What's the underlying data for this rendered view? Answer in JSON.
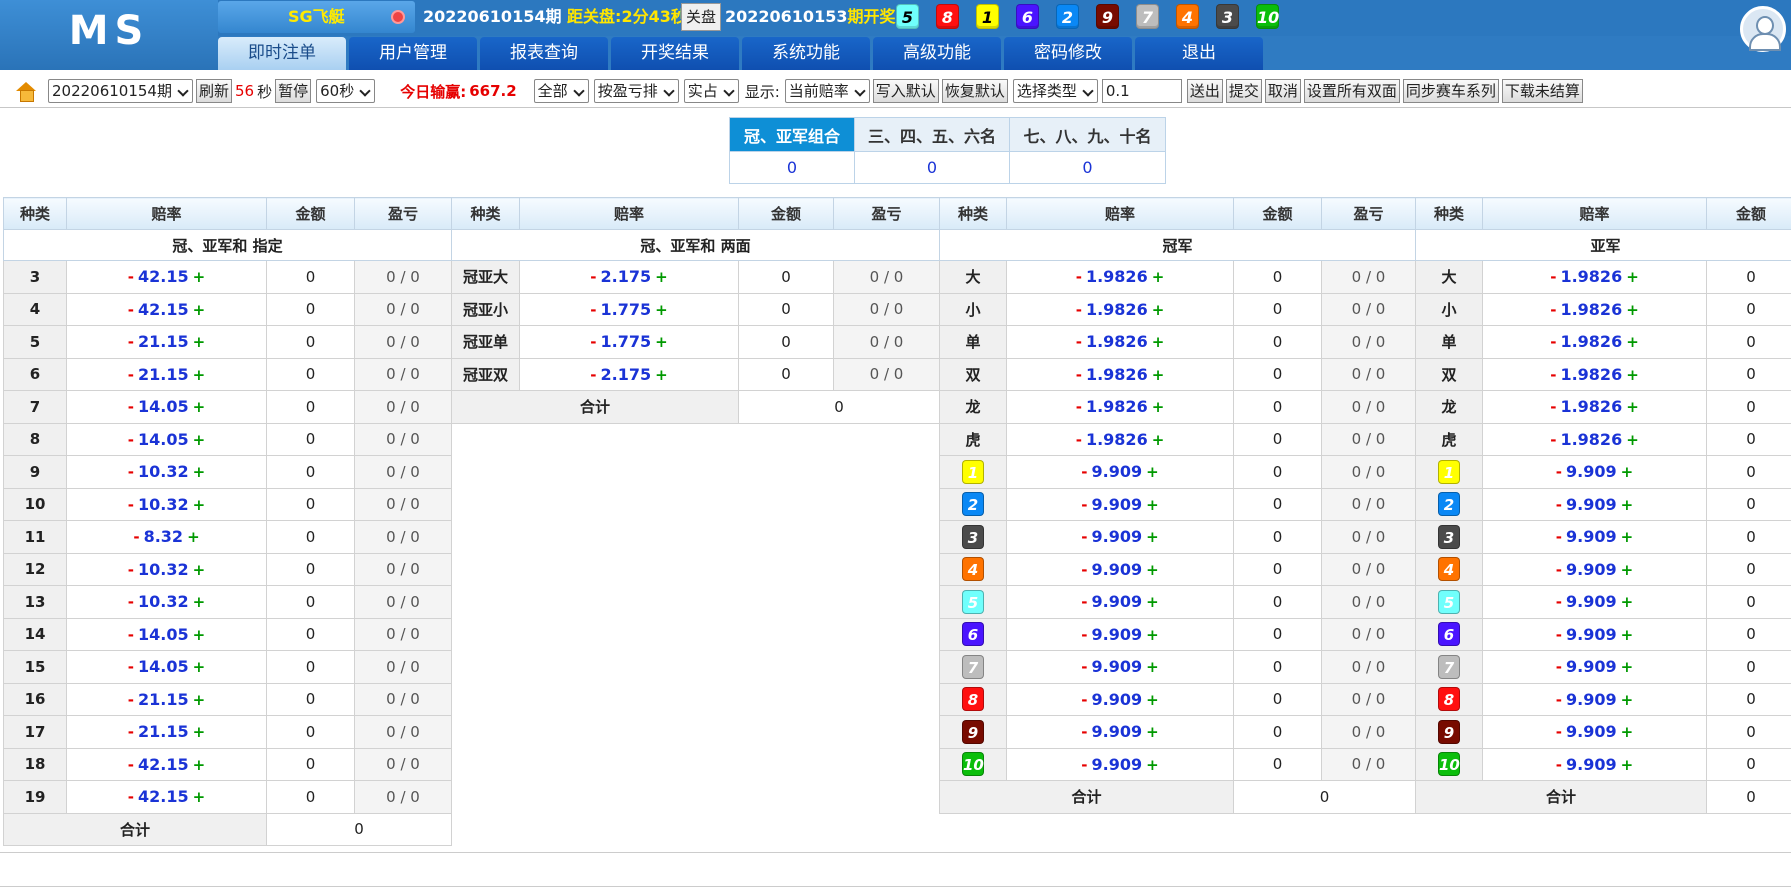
{
  "logo": "MS",
  "game": "SG飞艇",
  "issue": {
    "current": "20220610154期",
    "countdown_label": "距关盘:",
    "countdown": "2分43秒",
    "close_btn": "关盘",
    "prev": "20220610153",
    "prev_label": "期开奖:"
  },
  "result_balls": [
    5,
    8,
    1,
    6,
    2,
    9,
    7,
    4,
    3,
    10
  ],
  "nav": [
    "即时注单",
    "用户管理",
    "报表查询",
    "开奖结果",
    "系统功能",
    "高级功能",
    "密码修改",
    "退出"
  ],
  "toolbar": {
    "period": "20220610154期",
    "refresh": "刷新",
    "seconds": "56",
    "sec_unit": "秒",
    "pause": "暂停",
    "interval": "60秒",
    "win_label": "今日输赢:",
    "win_value": "667.2",
    "all": "全部",
    "sort": "按盈亏排",
    "real": "实占",
    "show_label": "显示:",
    "show": "当前赔率",
    "write_default": "写入默认",
    "restore_default": "恢复默认",
    "select_type": "选择类型",
    "step": "0.1",
    "send": "送出",
    "submit": "提交",
    "cancel": "取消",
    "set_all": "设置所有双面",
    "sync": "同步赛车系列",
    "download": "下载未结算"
  },
  "summary": {
    "headers": [
      "冠、亚军组合",
      "三、四、五、六名",
      "七、八、九、十名"
    ],
    "values": [
      "0",
      "0",
      "0"
    ]
  },
  "colheads": {
    "type": "种类",
    "odds": "赔率",
    "amount": "金额",
    "pl": "盈亏",
    "total": "合计"
  },
  "sections": {
    "sum_specific": "冠、亚军和 指定",
    "sum_two": "冠、亚军和 两面",
    "champion": "冠军",
    "runner": "亚军"
  },
  "sum_specific": [
    {
      "k": "3",
      "o": "42.15"
    },
    {
      "k": "4",
      "o": "42.15"
    },
    {
      "k": "5",
      "o": "21.15"
    },
    {
      "k": "6",
      "o": "21.15"
    },
    {
      "k": "7",
      "o": "14.05"
    },
    {
      "k": "8",
      "o": "14.05"
    },
    {
      "k": "9",
      "o": "10.32"
    },
    {
      "k": "10",
      "o": "10.32"
    },
    {
      "k": "11",
      "o": "8.32"
    },
    {
      "k": "12",
      "o": "10.32"
    },
    {
      "k": "13",
      "o": "10.32"
    },
    {
      "k": "14",
      "o": "14.05"
    },
    {
      "k": "15",
      "o": "14.05"
    },
    {
      "k": "16",
      "o": "21.15"
    },
    {
      "k": "17",
      "o": "21.15"
    },
    {
      "k": "18",
      "o": "42.15"
    },
    {
      "k": "19",
      "o": "42.15"
    }
  ],
  "sum_two": [
    {
      "k": "冠亚大",
      "o": "2.175"
    },
    {
      "k": "冠亚小",
      "o": "1.775"
    },
    {
      "k": "冠亚单",
      "o": "1.775"
    },
    {
      "k": "冠亚双",
      "o": "2.175"
    }
  ],
  "champion": [
    {
      "k": "大",
      "o": "1.9826"
    },
    {
      "k": "小",
      "o": "1.9826"
    },
    {
      "k": "单",
      "o": "1.9826"
    },
    {
      "k": "双",
      "o": "1.9826"
    },
    {
      "k": "龙",
      "o": "1.9826"
    },
    {
      "k": "虎",
      "o": "1.9826"
    },
    {
      "n": 1,
      "o": "9.909"
    },
    {
      "n": 2,
      "o": "9.909"
    },
    {
      "n": 3,
      "o": "9.909"
    },
    {
      "n": 4,
      "o": "9.909"
    },
    {
      "n": 5,
      "o": "9.909"
    },
    {
      "n": 6,
      "o": "9.909"
    },
    {
      "n": 7,
      "o": "9.909"
    },
    {
      "n": 8,
      "o": "9.909"
    },
    {
      "n": 9,
      "o": "9.909"
    },
    {
      "n": 10,
      "o": "9.909"
    }
  ],
  "runner": [
    {
      "k": "大",
      "o": "1.9826"
    },
    {
      "k": "小",
      "o": "1.9826"
    },
    {
      "k": "单",
      "o": "1.9826"
    },
    {
      "k": "双",
      "o": "1.9826"
    },
    {
      "k": "龙",
      "o": "1.9826"
    },
    {
      "k": "虎",
      "o": "1.9826"
    },
    {
      "n": 1,
      "o": "9.909"
    },
    {
      "n": 2,
      "o": "9.909"
    },
    {
      "n": 3,
      "o": "9.909"
    },
    {
      "n": 4,
      "o": "9.909"
    },
    {
      "n": 5,
      "o": "9.909"
    },
    {
      "n": 6,
      "o": "9.909"
    },
    {
      "n": 7,
      "o": "9.909"
    },
    {
      "n": 8,
      "o": "9.909"
    },
    {
      "n": 9,
      "o": "9.909"
    },
    {
      "n": 10,
      "o": "9.909"
    }
  ],
  "cell": {
    "amount": "0",
    "pl": "0 / 0",
    "total": "0",
    "minus": "-",
    "plus": "+"
  }
}
